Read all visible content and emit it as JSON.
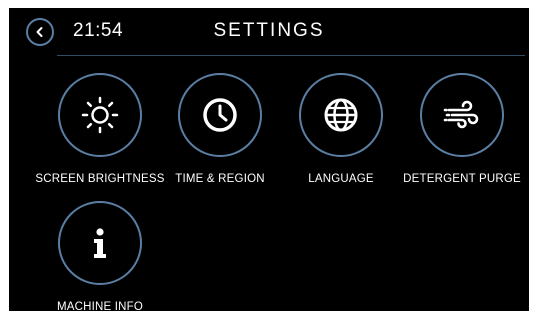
{
  "header": {
    "time": "21:54",
    "title": "SETTINGS",
    "back_icon": "chevron-left-icon"
  },
  "colors": {
    "background": "#000000",
    "accent_ring": "#5a7fa3",
    "text": "#ffffff"
  },
  "settings": [
    {
      "label": "SCREEN BRIGHTNESS",
      "icon": "sun-icon"
    },
    {
      "label": "TIME & REGION",
      "icon": "clock-icon"
    },
    {
      "label": "LANGUAGE",
      "icon": "globe-icon"
    },
    {
      "label": "DETERGENT PURGE",
      "icon": "wind-icon"
    },
    {
      "label": "MACHINE INFO",
      "icon": "info-icon"
    }
  ]
}
